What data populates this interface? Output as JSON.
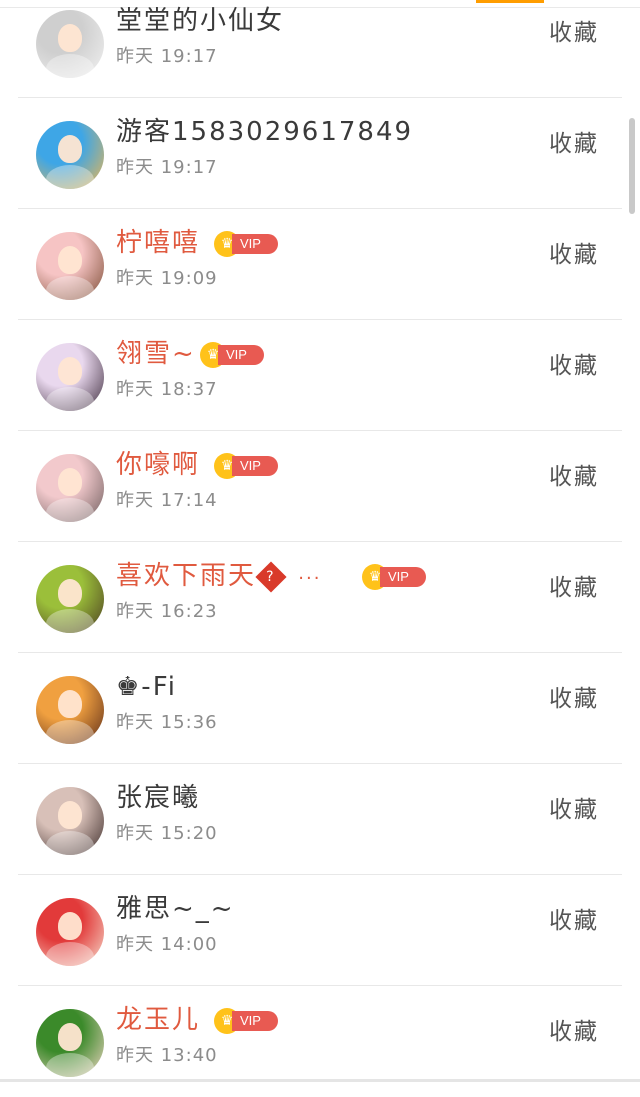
{
  "tab_indicator_color": "#ff9d00",
  "collect_label": "收藏",
  "vip_label": "VIP",
  "rows": [
    {
      "name": "堂堂的小仙女",
      "time": "昨天 19:17",
      "vip": false,
      "avatar_colors": [
        "#cfcfcf",
        "#f2f2f2"
      ]
    },
    {
      "name": "游客1583029617849",
      "time": "昨天 19:17",
      "vip": false,
      "avatar_colors": [
        "#3ea6e6",
        "#f3b64a"
      ]
    },
    {
      "name": "柠嘻嘻",
      "time": "昨天 19:09",
      "vip": true,
      "avatar_colors": [
        "#f6c4c4",
        "#7a4a32"
      ]
    },
    {
      "name": "翎雪~",
      "time": "昨天 18:37",
      "vip": true,
      "avatar_colors": [
        "#e9d8ee",
        "#3b2a3a"
      ]
    },
    {
      "name": "你嚎啊",
      "time": "昨天 17:14",
      "vip": true,
      "avatar_colors": [
        "#f2c9cc",
        "#6b5a5a"
      ]
    },
    {
      "name": "喜欢下雨天",
      "name_suffix": "?",
      "name_ellipsis": "···",
      "time": "昨天 16:23",
      "vip": true,
      "avatar_colors": [
        "#9bbf3a",
        "#4a3a22"
      ]
    },
    {
      "name": "♚-Fi",
      "time": "昨天 15:36",
      "vip": false,
      "avatar_colors": [
        "#f0a040",
        "#5a2a18"
      ]
    },
    {
      "name": "张宸曦",
      "time": "昨天 15:20",
      "vip": false,
      "avatar_colors": [
        "#d8c0b8",
        "#3a2a28"
      ]
    },
    {
      "name": "雅思~_~",
      "time": "昨天 14:00",
      "vip": false,
      "avatar_colors": [
        "#e23a3a",
        "#f6e0d0"
      ]
    },
    {
      "name": "龙玉儿",
      "time": "昨天 13:40",
      "vip": true,
      "avatar_colors": [
        "#3b8a2a",
        "#f2d6c6"
      ]
    }
  ]
}
